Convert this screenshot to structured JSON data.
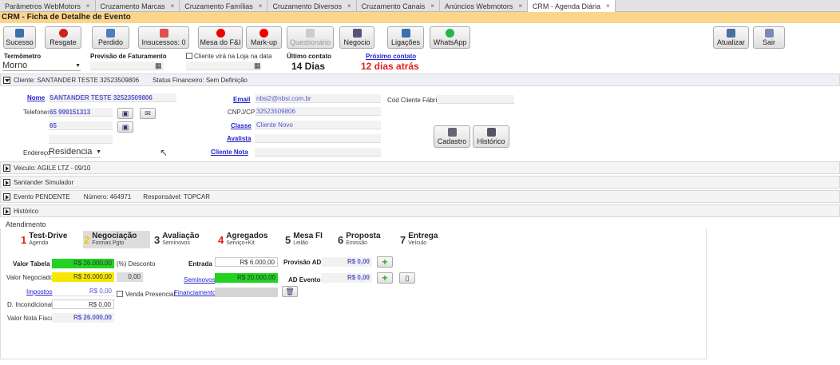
{
  "tabs": [
    {
      "label": "Parâmetros WebMotors",
      "close": "×"
    },
    {
      "label": "Cruzamento Marcas",
      "close": "×"
    },
    {
      "label": "Cruzamento Famílias",
      "close": "×"
    },
    {
      "label": "Cruzamento Diversos",
      "close": "×"
    },
    {
      "label": "Cruzamento Canais",
      "close": "×"
    },
    {
      "label": "Anúncios Webmotors",
      "close": "×"
    },
    {
      "label": "CRM - Agenda Diária",
      "close": "×"
    }
  ],
  "title": "CRM - Ficha de Detalhe de Evento",
  "toolbar": {
    "sucesso": "Sucesso",
    "resgate": "Resgate",
    "perdido": "Perdido",
    "insucessos": "Insucessos: 0",
    "mesa": "Mesa do F&I",
    "markup": "Mark-up",
    "questionario": "Questionário",
    "negocio": "Negocio",
    "ligacoes": "Ligações",
    "whatsapp": "WhatsApp",
    "atualizar": "Atualizar",
    "sair": "Sair"
  },
  "header": {
    "termometro_label": "Termômetro",
    "termometro_value": "Morno",
    "previsao_label": "Previsão de Faturamento",
    "cliente_loja_label": "Cliente virá na Loja na data",
    "ultimo_contato_label": "Último contato",
    "ultimo_contato_value": "14 Dias",
    "proximo_contato_label": "Próximo contato",
    "proximo_contato_value": "12 dias atrás"
  },
  "cliente": {
    "section": "Cliente: SANTANDER TESTE 32523509806",
    "status": "Status Financeiro: Sem Definição",
    "nome_label": "Nome",
    "nome_value": "SANTANDER TESTE 32523509806",
    "telefones_label": "Telefones",
    "tel1": "65 999151313",
    "tel2": "65",
    "endereco_label": "Endereço",
    "endereco_value": "Residencia",
    "email_label": "Email",
    "email_value": "nbsi2@nbsi.com.br",
    "cnpj_label": "CNPJ/CPF",
    "cnpj_value": "32523509806",
    "classe_label": "Classe",
    "classe_value": "Cliente Novo",
    "avalista_label": "Avalista",
    "cliente_nota_label": "Cliente Nota",
    "cod_label": "Cód Cliente Fábrica",
    "cadastro": "Cadastro",
    "historico_btn": "Histórico"
  },
  "sections": {
    "veiculo": "Veiculo: AGILE LTZ - 09/10",
    "simulador": "Santander Simulador",
    "evento": "Evento PENDENTE",
    "numero": "Número: 464971",
    "responsavel": "Responsável: TOPCAR",
    "historico": "Histórico"
  },
  "atendimento": "Atendimento",
  "steps": [
    {
      "num": "1",
      "title": "Test-Drive",
      "sub": "Agenda",
      "color": "#e02020"
    },
    {
      "num": "2",
      "title": "Negociação",
      "sub": "Formas Pgto",
      "color": "#e8c800"
    },
    {
      "num": "3",
      "title": "Avaliação",
      "sub": "Seminovos",
      "color": "#222"
    },
    {
      "num": "4",
      "title": "Agregados",
      "sub": "Serviço+Kit",
      "color": "#e02020"
    },
    {
      "num": "5",
      "title": "Mesa FI",
      "sub": "Leilão",
      "color": "#222"
    },
    {
      "num": "6",
      "title": "Proposta",
      "sub": "Emissão",
      "color": "#222"
    },
    {
      "num": "7",
      "title": "Entrega",
      "sub": "Veículo",
      "color": "#222"
    }
  ],
  "neg": {
    "valor_tabela_label": "Valor Tabela",
    "valor_tabela": "R$ 26.000,00",
    "desconto_label": "(%) Desconto",
    "valor_negociado_label": "Valor Negociado*",
    "valor_negociado": "R$ 26.000,00",
    "desconto_value": "0,00",
    "impostos_label": "Impostos",
    "impostos": "R$ 0,00",
    "venda_presencial": "Venda Presencial",
    "d_incondicional_label": "D. Incondicional",
    "d_incondicional": "R$ 0,00",
    "valor_nota_label": "Valor Nota Fiscal",
    "valor_nota": "R$ 26.000,00",
    "entrada_label": "Entrada",
    "entrada": "R$ 6.000,00",
    "seminovos_label": "Seminovos",
    "seminovos": "R$ 20.000,00",
    "financiamento_label": "Financiamento",
    "provisao_label": "Provisão AD",
    "provisao": "R$ 0,00",
    "ad_evento_label": "AD Evento",
    "ad_evento": "R$ 0,00"
  }
}
